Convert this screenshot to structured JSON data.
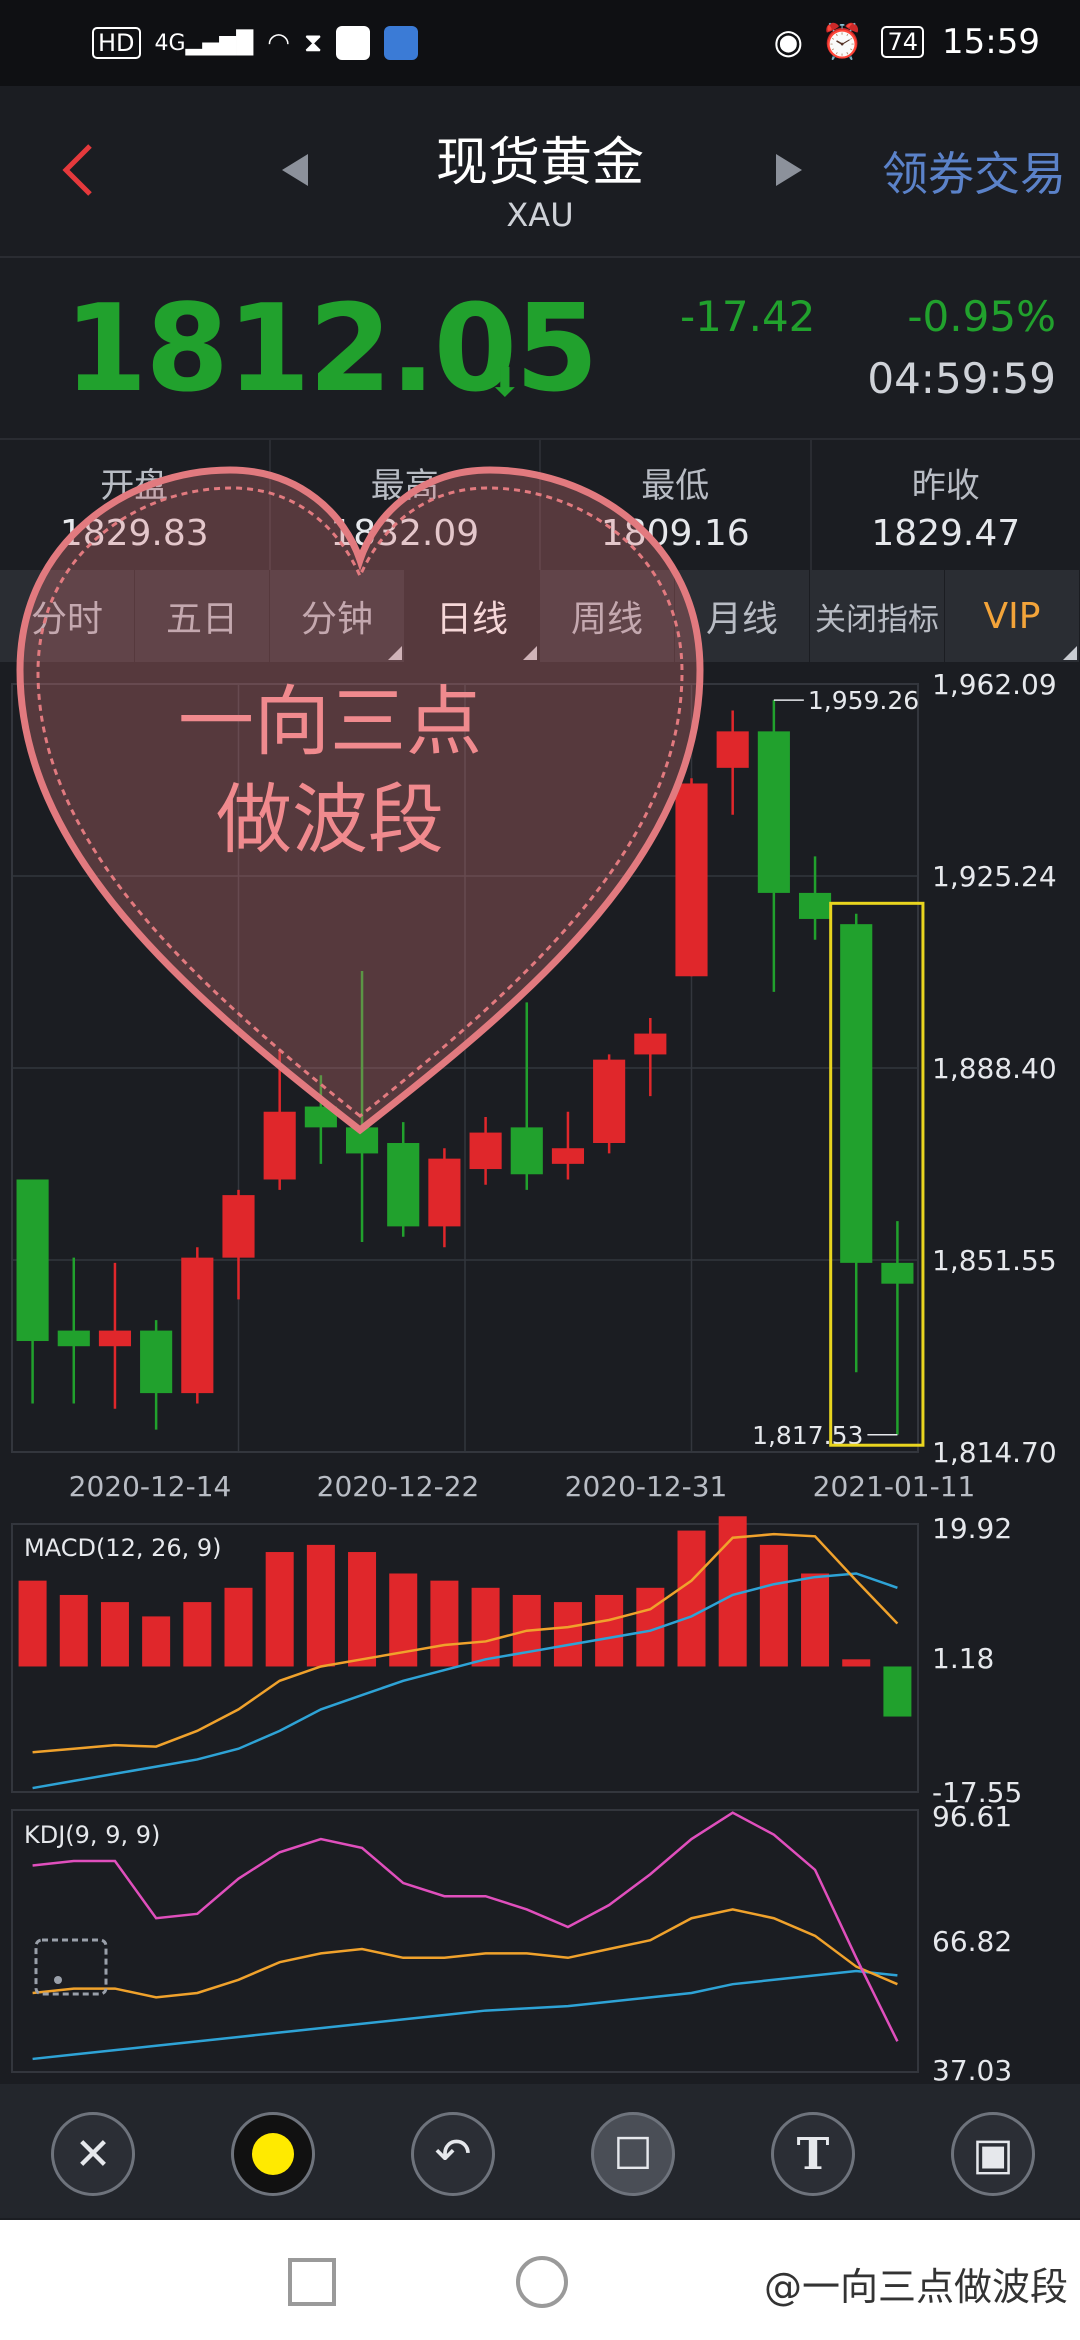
{
  "status_bar": {
    "left_icons": [
      "hd-icon",
      "signal-4g-icon",
      "wifi-icon",
      "hourglass-icon",
      "app-icon",
      "app-icon-2"
    ],
    "hd": "HD",
    "net": "4G",
    "battery": "74",
    "time": "15:59"
  },
  "header": {
    "title": "现货黄金",
    "subtitle": "XAU",
    "right_link": "领券交易"
  },
  "quote": {
    "price": "1812.05",
    "change": "-17.42",
    "change_pct": "-0.95%",
    "time": "04:59:59"
  },
  "stats": [
    {
      "label": "开盘",
      "value": "1829.83"
    },
    {
      "label": "最高",
      "value": "1832.09"
    },
    {
      "label": "最低",
      "value": "1809.16"
    },
    {
      "label": "昨收",
      "value": "1829.47"
    }
  ],
  "tabs": [
    {
      "label": "分时"
    },
    {
      "label": "五日"
    },
    {
      "label": "分钟"
    },
    {
      "label": "日线"
    },
    {
      "label": "周线"
    },
    {
      "label": "月线"
    },
    {
      "label": "关闭指标"
    },
    {
      "label": "VIP"
    }
  ],
  "overlay": {
    "line1": "一向三点",
    "line2": "做波段"
  },
  "colors": {
    "up": "#e0272b",
    "down": "#21a12d",
    "grid": "#33363d",
    "highlight": "#e9d51f",
    "heart": "#e27a7f"
  },
  "chart_data": {
    "type": "candlestick",
    "y_axis_labels": [
      "1,962.09",
      "1,925.24",
      "1,888.40",
      "1,851.55",
      "1,814.70"
    ],
    "ylim": [
      1814.7,
      1962.09
    ],
    "x_tick_labels": [
      "2020-12-14",
      "2020-12-22",
      "2020-12-31",
      "2021-01-11"
    ],
    "max_label": "1,959.26",
    "min_label": "1,817.53",
    "candles": [
      {
        "o": 1867,
        "c": 1836,
        "h": 1867,
        "l": 1824,
        "up": false
      },
      {
        "o": 1838,
        "c": 1835,
        "h": 1852,
        "l": 1824,
        "up": false
      },
      {
        "o": 1835,
        "c": 1838,
        "h": 1851,
        "l": 1823,
        "up": true
      },
      {
        "o": 1838,
        "c": 1826,
        "h": 1840,
        "l": 1819,
        "up": false
      },
      {
        "o": 1826,
        "c": 1852,
        "h": 1854,
        "l": 1824,
        "up": true
      },
      {
        "o": 1852,
        "c": 1864,
        "h": 1865,
        "l": 1844,
        "up": true
      },
      {
        "o": 1867,
        "c": 1880,
        "h": 1892,
        "l": 1865,
        "up": true
      },
      {
        "o": 1881,
        "c": 1877,
        "h": 1887,
        "l": 1870,
        "up": false
      },
      {
        "o": 1877,
        "c": 1872,
        "h": 1907,
        "l": 1855,
        "up": false
      },
      {
        "o": 1874,
        "c": 1858,
        "h": 1878,
        "l": 1856,
        "up": false
      },
      {
        "o": 1858,
        "c": 1871,
        "h": 1873,
        "l": 1854,
        "up": true
      },
      {
        "o": 1869,
        "c": 1876,
        "h": 1879,
        "l": 1866,
        "up": true
      },
      {
        "o": 1877,
        "c": 1868,
        "h": 1901,
        "l": 1865,
        "up": false
      },
      {
        "o": 1870,
        "c": 1873,
        "h": 1880,
        "l": 1867,
        "up": true
      },
      {
        "o": 1874,
        "c": 1890,
        "h": 1891,
        "l": 1872,
        "up": true
      },
      {
        "o": 1891,
        "c": 1895,
        "h": 1898,
        "l": 1883,
        "up": true
      },
      {
        "o": 1906,
        "c": 1943,
        "h": 1944,
        "l": 1906,
        "up": true
      },
      {
        "o": 1946,
        "c": 1953,
        "h": 1957,
        "l": 1937,
        "up": true
      },
      {
        "o": 1953,
        "c": 1922,
        "h": 1959,
        "l": 1903,
        "up": false
      },
      {
        "o": 1922,
        "c": 1917,
        "h": 1929,
        "l": 1913,
        "up": false
      },
      {
        "o": 1916,
        "c": 1851,
        "h": 1918,
        "l": 1830,
        "up": false
      },
      {
        "o": 1851,
        "c": 1847,
        "h": 1859,
        "l": 1818,
        "up": false
      }
    ],
    "macd": {
      "label": "MACD(12, 26, 9)",
      "y_axis_labels": [
        "19.92",
        "1.18",
        "-17.55"
      ],
      "ylim": [
        -17.55,
        19.92
      ],
      "hist": [
        12,
        10,
        9,
        7,
        9,
        11,
        16,
        17,
        16,
        13,
        12,
        11,
        10,
        9,
        10,
        11,
        19,
        21,
        17,
        13,
        1,
        -7
      ],
      "dif": [
        -12,
        -11.5,
        -11,
        -11.2,
        -9,
        -6,
        -2,
        0,
        1,
        2,
        3,
        3.5,
        5,
        5.5,
        6.5,
        8,
        12,
        18,
        18.5,
        18.2,
        12,
        6
      ],
      "dea": [
        -17,
        -16,
        -15,
        -14,
        -13,
        -11.5,
        -9,
        -6,
        -4,
        -2,
        -0.5,
        1,
        2,
        3,
        4,
        5,
        7,
        10,
        11.5,
        12.5,
        13,
        11
      ]
    },
    "kdj": {
      "label": "KDJ(9, 9, 9)",
      "y_axis_labels": [
        "96.61",
        "66.82",
        "37.03"
      ],
      "ylim": [
        37.03,
        96.61
      ],
      "j": [
        84,
        85,
        85,
        72,
        73,
        81,
        87,
        90,
        88,
        80,
        77,
        77,
        74,
        70,
        75,
        82,
        90,
        96,
        91,
        83,
        63,
        44
      ],
      "k": [
        55,
        56,
        56,
        54,
        55,
        58,
        62,
        64,
        65,
        63,
        63,
        64,
        64,
        63,
        65,
        67,
        72,
        74,
        72,
        68,
        61,
        57
      ],
      "d": [
        40,
        41,
        42,
        43,
        44,
        45,
        46,
        47,
        48,
        49,
        50,
        51,
        51.5,
        52,
        53,
        54,
        55,
        57,
        58,
        59,
        60,
        59
      ]
    }
  },
  "toolbar_icons": [
    "close-icon",
    "color-dot-icon",
    "undo-icon",
    "rectangle-icon",
    "text-icon",
    "save-icon"
  ],
  "watermark": "@一向三点做波段"
}
